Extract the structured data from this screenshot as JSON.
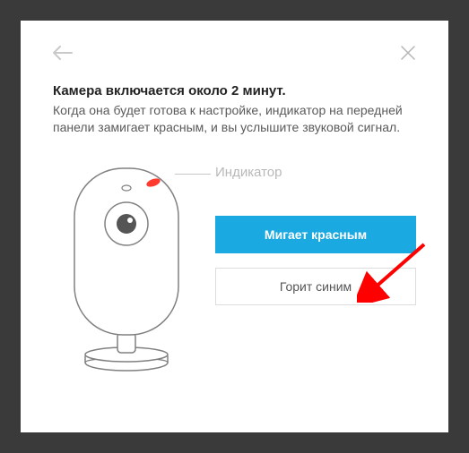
{
  "title": "Камера включается около 2 минут.",
  "description": "Когда она будет готова к настройке, индикатор на передней панели замигает красным, и вы услышите звуковой сигнал.",
  "indicator_label": "Индикатор",
  "buttons": {
    "blink_red": "Мигает красным",
    "solid_blue": "Горит синим"
  },
  "colors": {
    "primary": "#1aa9e0",
    "led": "#ff3b30"
  }
}
